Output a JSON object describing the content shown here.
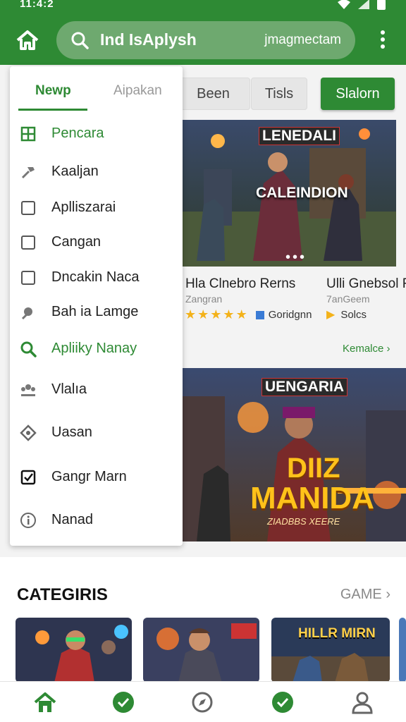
{
  "status": {
    "time": "11:4:2"
  },
  "header": {
    "search_text": "Ind IsAplysh",
    "search_right": "jmagmectam"
  },
  "chips": [
    "Been",
    "Tisls",
    "Slalorn"
  ],
  "drawer": {
    "tabs": [
      "Newp",
      "Aipakan"
    ],
    "items": [
      {
        "label": "Pencara",
        "icon": "grid-icon"
      },
      {
        "label": "Kaaljan",
        "icon": "hammer-icon"
      },
      {
        "label": "Aplliszarai",
        "icon": "checkbox-icon"
      },
      {
        "label": "Cangan",
        "icon": "checkbox-icon"
      },
      {
        "label": "Dncakin Naca",
        "icon": "checkbox-icon"
      },
      {
        "label": "Bah ia Lamge",
        "icon": "puzzle-icon"
      },
      {
        "label": "Apliiky Nanay",
        "icon": "search-icon"
      },
      {
        "label": "Vlalıa",
        "icon": "group-icon"
      },
      {
        "label": "Uasan",
        "icon": "diamond-icon"
      },
      {
        "label": "Gangr Marn",
        "icon": "checked-icon"
      },
      {
        "label": "Nanad",
        "icon": "info-icon"
      }
    ]
  },
  "cards": [
    {
      "banner_text": "LENEDALI",
      "banner_subtext": "CALEINDION",
      "title": "Hla Clnebro Rerns",
      "subtitle": "Zangran",
      "rating_label": "Goridgnn"
    },
    {
      "title": "Ulli Gnebsol R",
      "subtitle": "7anGeem",
      "rating_label": "Solcs"
    }
  ],
  "more_link": "Kemalce",
  "feature": {
    "banner_text": "UENGARIA",
    "big_text_1": "DIIZ",
    "big_text_2": "MANIDA",
    "small_text": "ZIADBBS XEERE"
  },
  "categories": {
    "title": "CATEGIRIS",
    "link": "GAME",
    "thumb3_text": "HILLR MIRN"
  },
  "colors": {
    "primary": "#2e8a34",
    "star": "#f3b21a"
  }
}
